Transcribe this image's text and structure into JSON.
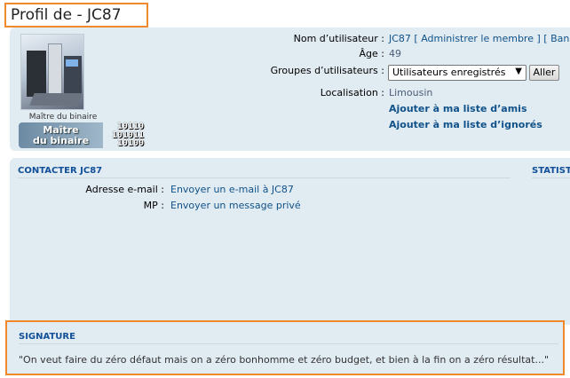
{
  "page": {
    "title": "Profil de - JC87"
  },
  "profile": {
    "avatar_alt": "avatar",
    "rank_title": "Maître du binaire",
    "rank_badge_text_1": "Maître",
    "rank_badge_text_2": "du binaire",
    "rank_binary": [
      "10110",
      "101011",
      "10100"
    ],
    "fields": {
      "username_label": "Nom d’utilisateur :",
      "username_value": "JC87",
      "admin_link": "[ Administrer le membre ]",
      "ban_link": "[ Ban",
      "age_label": "Âge :",
      "age_value": "49",
      "groups_label": "Groupes d’utilisateurs :",
      "groups_selected": "Utilisateurs enregistrés",
      "groups_button": "Aller",
      "location_label": "Localisation :",
      "location_value": "Limousin",
      "add_friend": "Ajouter à ma liste d’amis",
      "add_foe": "Ajouter à ma liste d’ignorés"
    }
  },
  "contact": {
    "heading": "CONTACTER JC87",
    "stats_heading": "STATISTI",
    "email_label": "Adresse e-mail :",
    "email_link": "Envoyer un e-mail à JC87",
    "pm_label": "MP :",
    "pm_link": "Envoyer un message privé"
  },
  "signature": {
    "heading": "SIGNATURE",
    "text": "\"On veut faire du zéro défaut mais on a zéro bonhomme et zéro budget, et bien à la fin on a zéro résultat...\""
  },
  "colors": {
    "highlight_border": "#f0882c",
    "panel_bg": "#e1ebf2",
    "link": "#105289",
    "heading": "#115098"
  }
}
